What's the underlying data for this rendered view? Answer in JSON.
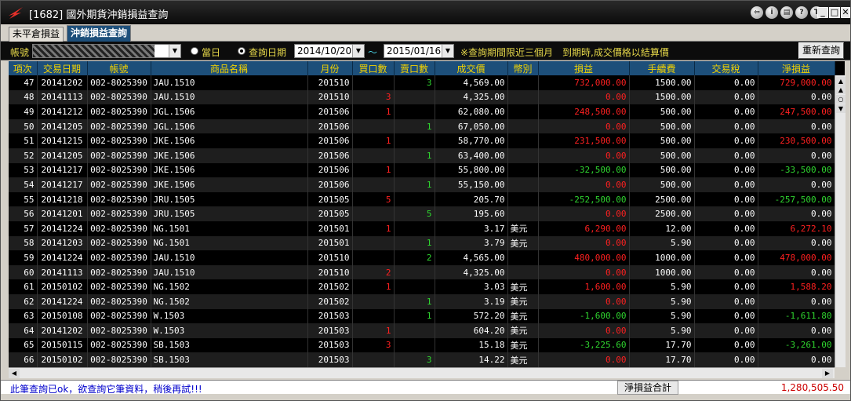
{
  "window": {
    "title": "[1682] 國外期貨沖銷損益查詢",
    "title_icons": [
      "back-icon",
      "info-icon",
      "print-icon",
      "help-icon",
      "t-icon"
    ],
    "controls": [
      "minimize-icon",
      "maximize-icon",
      "close-icon"
    ]
  },
  "tabs": [
    {
      "label": "未平倉損益",
      "active": false
    },
    {
      "label": "沖銷損益查詢",
      "active": true
    }
  ],
  "toolbar": {
    "account_label": "帳號",
    "radio_today": "當日",
    "radio_query_date": "查詢日期",
    "start_date": "2014/10/20",
    "tilde": "～",
    "end_date": "2015/01/16",
    "note": "※查詢期間限近三個月　到期時,成交價格以結算價",
    "refresh_label": "重新查詢"
  },
  "columns": [
    "項次",
    "交易日期",
    "帳號",
    "商品名稱",
    "月份",
    "買口數",
    "賣口數",
    "成交價",
    "幣別",
    "損益",
    "手續費",
    "交易稅",
    "淨損益"
  ],
  "rows": [
    {
      "no": "47",
      "date": "20141202",
      "acct": "002-8025390",
      "name": "JAU.1510",
      "month": "201510",
      "buy": "",
      "sell": "3",
      "price": "4,569.00",
      "cur": "",
      "pnl": "732,000.00",
      "fee": "1500.00",
      "tax": "0.00",
      "net": "729,000.00",
      "pnl_c": "red",
      "net_c": "red"
    },
    {
      "no": "48",
      "date": "20141113",
      "acct": "002-8025390",
      "name": "JAU.1510",
      "month": "201510",
      "buy": "3",
      "sell": "",
      "price": "4,325.00",
      "cur": "",
      "pnl": "0.00",
      "fee": "1500.00",
      "tax": "0.00",
      "net": "0.00",
      "pnl_c": "red",
      "net_c": "white"
    },
    {
      "no": "49",
      "date": "20141212",
      "acct": "002-8025390",
      "name": "JGL.1506",
      "month": "201506",
      "buy": "1",
      "sell": "",
      "price": "62,080.00",
      "cur": "",
      "pnl": "248,500.00",
      "fee": "500.00",
      "tax": "0.00",
      "net": "247,500.00",
      "pnl_c": "red",
      "net_c": "red"
    },
    {
      "no": "50",
      "date": "20141205",
      "acct": "002-8025390",
      "name": "JGL.1506",
      "month": "201506",
      "buy": "",
      "sell": "1",
      "price": "67,050.00",
      "cur": "",
      "pnl": "0.00",
      "fee": "500.00",
      "tax": "0.00",
      "net": "0.00",
      "pnl_c": "red",
      "net_c": "white"
    },
    {
      "no": "51",
      "date": "20141215",
      "acct": "002-8025390",
      "name": "JKE.1506",
      "month": "201506",
      "buy": "1",
      "sell": "",
      "price": "58,770.00",
      "cur": "",
      "pnl": "231,500.00",
      "fee": "500.00",
      "tax": "0.00",
      "net": "230,500.00",
      "pnl_c": "red",
      "net_c": "red"
    },
    {
      "no": "52",
      "date": "20141205",
      "acct": "002-8025390",
      "name": "JKE.1506",
      "month": "201506",
      "buy": "",
      "sell": "1",
      "price": "63,400.00",
      "cur": "",
      "pnl": "0.00",
      "fee": "500.00",
      "tax": "0.00",
      "net": "0.00",
      "pnl_c": "red",
      "net_c": "white"
    },
    {
      "no": "53",
      "date": "20141217",
      "acct": "002-8025390",
      "name": "JKE.1506",
      "month": "201506",
      "buy": "1",
      "sell": "",
      "price": "55,800.00",
      "cur": "",
      "pnl": "-32,500.00",
      "fee": "500.00",
      "tax": "0.00",
      "net": "-33,500.00",
      "pnl_c": "green",
      "net_c": "green"
    },
    {
      "no": "54",
      "date": "20141217",
      "acct": "002-8025390",
      "name": "JKE.1506",
      "month": "201506",
      "buy": "",
      "sell": "1",
      "price": "55,150.00",
      "cur": "",
      "pnl": "0.00",
      "fee": "500.00",
      "tax": "0.00",
      "net": "0.00",
      "pnl_c": "red",
      "net_c": "white"
    },
    {
      "no": "55",
      "date": "20141218",
      "acct": "002-8025390",
      "name": "JRU.1505",
      "month": "201505",
      "buy": "5",
      "sell": "",
      "price": "205.70",
      "cur": "",
      "pnl": "-252,500.00",
      "fee": "2500.00",
      "tax": "0.00",
      "net": "-257,500.00",
      "pnl_c": "green",
      "net_c": "green"
    },
    {
      "no": "56",
      "date": "20141201",
      "acct": "002-8025390",
      "name": "JRU.1505",
      "month": "201505",
      "buy": "",
      "sell": "5",
      "price": "195.60",
      "cur": "",
      "pnl": "0.00",
      "fee": "2500.00",
      "tax": "0.00",
      "net": "0.00",
      "pnl_c": "red",
      "net_c": "white"
    },
    {
      "no": "57",
      "date": "20141224",
      "acct": "002-8025390",
      "name": "NG.1501",
      "month": "201501",
      "buy": "1",
      "sell": "",
      "price": "3.17",
      "cur": "美元",
      "pnl": "6,290.00",
      "fee": "12.00",
      "tax": "0.00",
      "net": "6,272.10",
      "pnl_c": "red",
      "net_c": "red"
    },
    {
      "no": "58",
      "date": "20141203",
      "acct": "002-8025390",
      "name": "NG.1501",
      "month": "201501",
      "buy": "",
      "sell": "1",
      "price": "3.79",
      "cur": "美元",
      "pnl": "0.00",
      "fee": "5.90",
      "tax": "0.00",
      "net": "0.00",
      "pnl_c": "red",
      "net_c": "white"
    },
    {
      "no": "59",
      "date": "20141224",
      "acct": "002-8025390",
      "name": "JAU.1510",
      "month": "201510",
      "buy": "",
      "sell": "2",
      "price": "4,565.00",
      "cur": "",
      "pnl": "480,000.00",
      "fee": "1000.00",
      "tax": "0.00",
      "net": "478,000.00",
      "pnl_c": "red",
      "net_c": "red"
    },
    {
      "no": "60",
      "date": "20141113",
      "acct": "002-8025390",
      "name": "JAU.1510",
      "month": "201510",
      "buy": "2",
      "sell": "",
      "price": "4,325.00",
      "cur": "",
      "pnl": "0.00",
      "fee": "1000.00",
      "tax": "0.00",
      "net": "0.00",
      "pnl_c": "red",
      "net_c": "white"
    },
    {
      "no": "61",
      "date": "20150102",
      "acct": "002-8025390",
      "name": "NG.1502",
      "month": "201502",
      "buy": "1",
      "sell": "",
      "price": "3.03",
      "cur": "美元",
      "pnl": "1,600.00",
      "fee": "5.90",
      "tax": "0.00",
      "net": "1,588.20",
      "pnl_c": "red",
      "net_c": "red"
    },
    {
      "no": "62",
      "date": "20141224",
      "acct": "002-8025390",
      "name": "NG.1502",
      "month": "201502",
      "buy": "",
      "sell": "1",
      "price": "3.19",
      "cur": "美元",
      "pnl": "0.00",
      "fee": "5.90",
      "tax": "0.00",
      "net": "0.00",
      "pnl_c": "red",
      "net_c": "white"
    },
    {
      "no": "63",
      "date": "20150108",
      "acct": "002-8025390",
      "name": "W.1503",
      "month": "201503",
      "buy": "",
      "sell": "1",
      "price": "572.20",
      "cur": "美元",
      "pnl": "-1,600.00",
      "fee": "5.90",
      "tax": "0.00",
      "net": "-1,611.80",
      "pnl_c": "green",
      "net_c": "green"
    },
    {
      "no": "64",
      "date": "20141202",
      "acct": "002-8025390",
      "name": "W.1503",
      "month": "201503",
      "buy": "1",
      "sell": "",
      "price": "604.20",
      "cur": "美元",
      "pnl": "0.00",
      "fee": "5.90",
      "tax": "0.00",
      "net": "0.00",
      "pnl_c": "red",
      "net_c": "white"
    },
    {
      "no": "65",
      "date": "20150115",
      "acct": "002-8025390",
      "name": "SB.1503",
      "month": "201503",
      "buy": "3",
      "sell": "",
      "price": "15.18",
      "cur": "美元",
      "pnl": "-3,225.60",
      "fee": "17.70",
      "tax": "0.00",
      "net": "-3,261.00",
      "pnl_c": "green",
      "net_c": "green"
    },
    {
      "no": "66",
      "date": "20150102",
      "acct": "002-8025390",
      "name": "SB.1503",
      "month": "201503",
      "buy": "",
      "sell": "3",
      "price": "14.22",
      "cur": "美元",
      "pnl": "0.00",
      "fee": "17.70",
      "tax": "0.00",
      "net": "0.00",
      "pnl_c": "red",
      "net_c": "white"
    }
  ],
  "status": {
    "message": "此筆查詢已ok，欲查詢它筆資料，稍後再試!!!",
    "total_label": "淨損益合計",
    "total_value": "1,280,505.50"
  }
}
